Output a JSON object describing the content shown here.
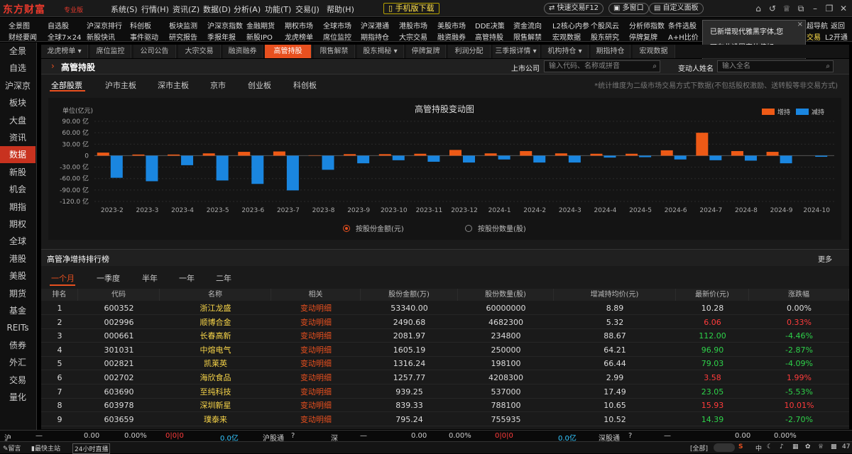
{
  "app": {
    "logo": "东方财富",
    "edition": "专业版"
  },
  "menu": [
    "系统(S)",
    "行情(H)",
    "资讯(Z)",
    "数据(D)",
    "分析(A)",
    "功能(T)",
    "交易(J)",
    "帮助(H)"
  ],
  "mobile_btn": "手机版下载",
  "toolbar": {
    "quick_trade": "快速交易F12",
    "multi_window": "多窗口",
    "custom_panel": "自定义面板"
  },
  "quickbar": {
    "row1": [
      "全景图",
      "自选股",
      "沪深京排行",
      "科创板",
      "板块监测",
      "沪深京指数",
      "金融期货",
      "期权市场",
      "全球市场",
      "沪深港通",
      "港股市场",
      "美股市场",
      "DDE决策",
      "资金流向",
      "L2核心内参",
      "个股风云",
      "分析师指数",
      "条件选股"
    ],
    "row2": [
      "财经要闻",
      "全球7×24",
      "新股快讯",
      "事件驱动",
      "研究报告",
      "季报年报",
      "新股IPO",
      "龙虎榜单",
      "席位监控",
      "期指持仓",
      "大宗交易",
      "融资融券",
      "高管持股",
      "限售解禁",
      "宏观数据",
      "股东研究",
      "停牌复牌",
      "A+H比价"
    ],
    "right": [
      "超导航",
      "返回",
      "交易",
      "L2开通"
    ]
  },
  "tooltip": {
    "text1": "已新增现代雅黑字体,您",
    "text2": "可在此设置字体偏好。",
    "close": "×"
  },
  "sidebar": [
    "全景",
    "自选",
    "沪深京",
    "板块",
    "大盘",
    "资讯",
    "数据",
    "新股",
    "机会",
    "期指",
    "期权",
    "全球",
    "港股",
    "美股",
    "期货",
    "基金",
    "REITs",
    "债券",
    "外汇",
    "交易",
    "量化"
  ],
  "tabs": [
    "龙虎榜单 ▾",
    "席位监控",
    "公司公告",
    "大宗交易",
    "融资融券",
    "高管持股",
    "限售解禁",
    "股东揭秘 ▾",
    "停牌复牌",
    "利润分配",
    "三季报详情 ▾",
    "机构持仓 ▾",
    "期指持仓",
    "宏观数据"
  ],
  "header": {
    "arrow": "›",
    "title": "高管持股",
    "listed_label": "上市公司",
    "listed_placeholder": "输入代码、名称或拼音",
    "person_label": "变动人姓名",
    "person_placeholder": "输入全名",
    "search_icon": "⌕"
  },
  "subtabs": [
    "全部股票",
    "沪市主板",
    "深市主板",
    "京市",
    "创业板",
    "科创板"
  ],
  "note": "*统计维度为二级市场交易方式下数据(不包括股权激励、送转股等非交易方式)",
  "chart_data": {
    "type": "bar",
    "title": "高管持股变动图",
    "ylabel": "单位(亿元)",
    "ylim": [
      -120,
      90
    ],
    "yticks": [
      "90.00 亿",
      "60.00 亿",
      "30.00 亿",
      "0",
      "-30.00 亿",
      "-60.00 亿",
      "-90.00 亿",
      "-120.0 亿"
    ],
    "yvals": [
      90,
      60,
      30,
      0,
      -30,
      -60,
      -90,
      -120
    ],
    "categories": [
      "2023-2",
      "2023-3",
      "2023-4",
      "2023-5",
      "2023-6",
      "2023-7",
      "2023-8",
      "2023-9",
      "2023-10",
      "2023-11",
      "2023-12",
      "2024-1",
      "2024-2",
      "2024-3",
      "2024-4",
      "2024-5",
      "2024-6",
      "2024-7",
      "2024-8",
      "2024-9",
      "2024-10"
    ],
    "legend": [
      "增持",
      "减持"
    ],
    "series": [
      {
        "name": "增持",
        "color": "#ee5a16",
        "values": [
          8,
          3,
          3,
          6,
          10,
          11,
          1,
          4,
          4,
          5,
          15,
          6,
          12,
          6,
          5,
          5,
          14,
          60,
          12,
          10,
          0
        ]
      },
      {
        "name": "减持",
        "color": "#1a86e0",
        "values": [
          -58,
          -67,
          -25,
          -65,
          -74,
          -91,
          -37,
          -20,
          -12,
          -16,
          -18,
          -10,
          -18,
          -18,
          -5,
          -4,
          -10,
          -12,
          -13,
          -20,
          -3
        ]
      }
    ]
  },
  "radios": {
    "amount": "按股份金额(元)",
    "quantity": "按股份数量(股)"
  },
  "rank": {
    "title": "高管净增持排行榜",
    "more": "更多"
  },
  "periods": [
    "一个月",
    "一季度",
    "半年",
    "一年",
    "二年"
  ],
  "table": {
    "headers": [
      "排名",
      "代码",
      "名称",
      "相关",
      "股份金额(万)",
      "股份数量(股)",
      "增减持均价(元)",
      "最新价(元)",
      "涨跌幅"
    ],
    "rows": [
      [
        "1",
        "600352",
        "浙江龙盛",
        "变动明细",
        "53340.00",
        "60000000",
        "8.89",
        "10.28",
        "0.00%"
      ],
      [
        "2",
        "002996",
        "顺博合金",
        "变动明细",
        "2490.68",
        "4682300",
        "5.32",
        "6.06",
        "0.33%"
      ],
      [
        "3",
        "000661",
        "长春高新",
        "变动明细",
        "2081.97",
        "234800",
        "88.67",
        "112.00",
        "-4.46%"
      ],
      [
        "4",
        "301031",
        "中熔电气",
        "变动明细",
        "1605.19",
        "250000",
        "64.21",
        "96.90",
        "-2.87%"
      ],
      [
        "5",
        "002821",
        "凯莱英",
        "变动明细",
        "1316.24",
        "198100",
        "66.44",
        "79.03",
        "-4.09%"
      ],
      [
        "6",
        "002702",
        "海欣食品",
        "变动明细",
        "1257.77",
        "4208300",
        "2.99",
        "3.58",
        "1.99%"
      ],
      [
        "7",
        "603690",
        "至纯科技",
        "变动明细",
        "939.25",
        "537000",
        "17.49",
        "23.05",
        "-5.53%"
      ],
      [
        "8",
        "603978",
        "深圳新星",
        "变动明细",
        "839.33",
        "788100",
        "10.65",
        "15.93",
        "10.01%"
      ],
      [
        "9",
        "603659",
        "璞泰来",
        "变动明细",
        "795.24",
        "755935",
        "10.52",
        "14.39",
        "-2.70%"
      ]
    ],
    "colors": [
      "",
      "",
      "",
      "",
      "",
      "",
      "",
      "dn",
      "flat",
      "up",
      "up",
      "dn",
      "dn",
      "dn",
      "dn",
      "dn",
      "dn",
      "dn",
      "up",
      "up",
      "up",
      "up",
      "up",
      "up",
      "dn",
      "dn",
      "dn"
    ]
  },
  "status": {
    "sh": "沪",
    "sh_dash": "—",
    "sh_val": "0.00",
    "sh_pct": "0.00%",
    "sh_cnt": "0|0|0",
    "sh_amt": "0.0亿",
    "hgt": "沪股通",
    "q": "?",
    "sz": "深",
    "sz_dash": "—",
    "sz_val": "0.00",
    "sz_pct": "0.00%",
    "sz_cnt": "0|0|0",
    "sz_amt": "0.0亿",
    "sgt": "深股通",
    "sgt_dash": "—",
    "sgt_val": "0.00",
    "sgt_pct": "0.00%"
  },
  "bottom": {
    "msg": "留言",
    "fast": "最快主站",
    "live": "24小时直播",
    "all": "[全部]",
    "count": "47"
  }
}
